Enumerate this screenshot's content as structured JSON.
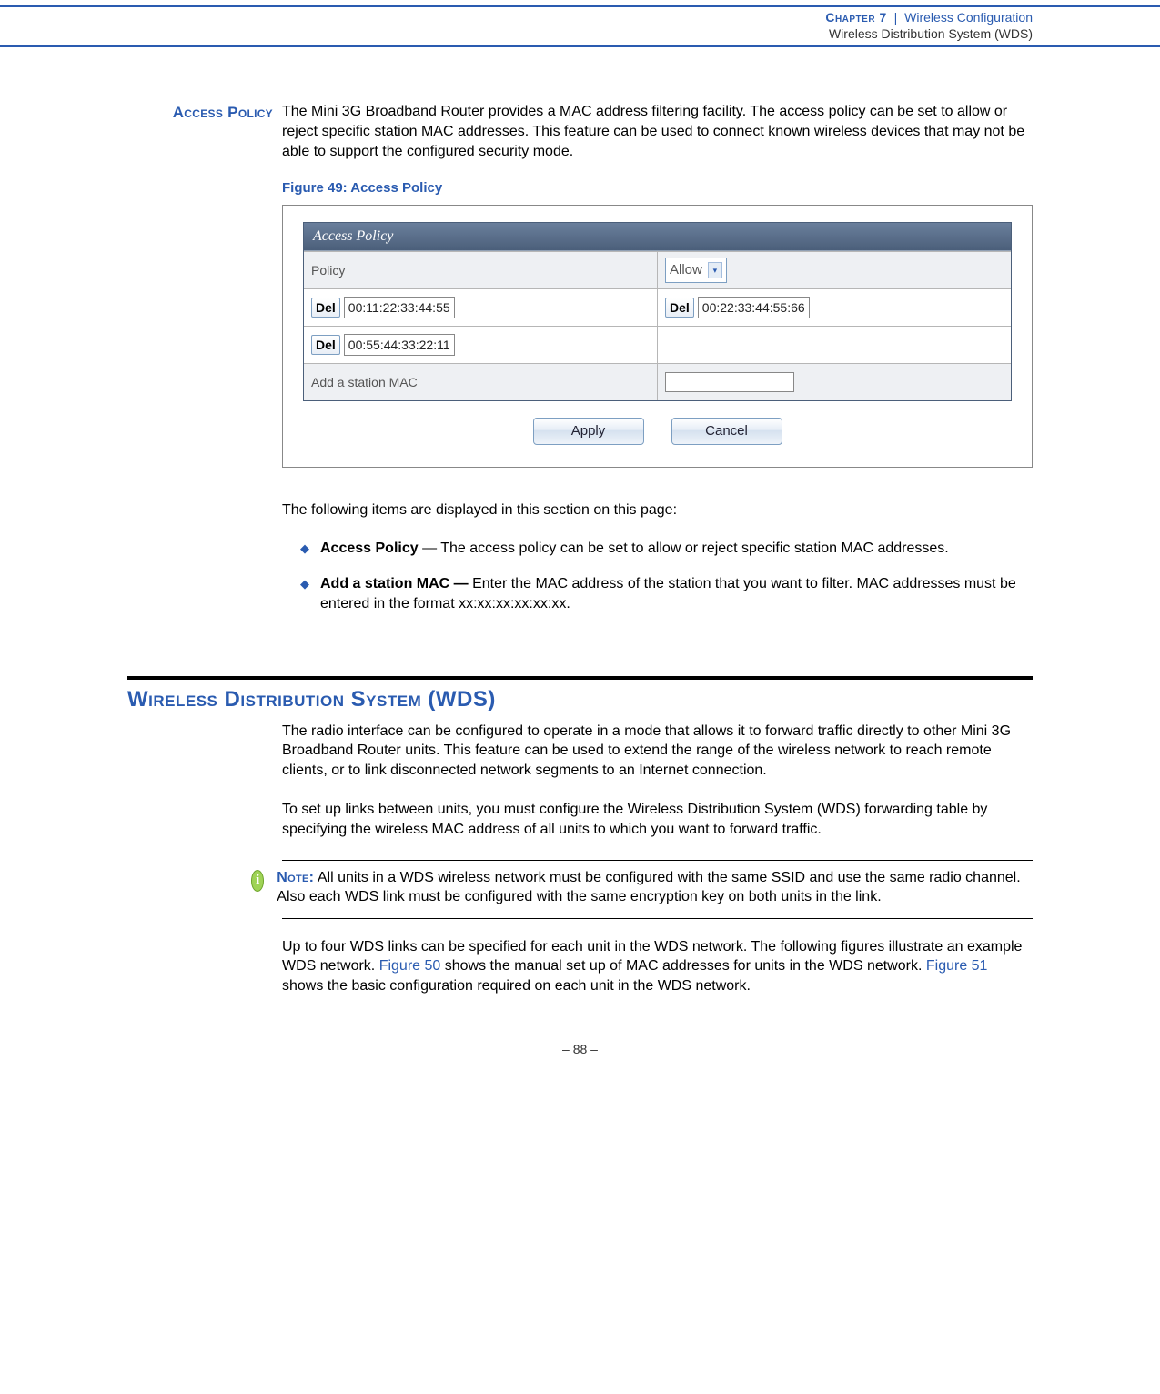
{
  "header": {
    "chapter": "Chapter 7",
    "pipe": "|",
    "topic": "Wireless Configuration",
    "subtitle": "Wireless Distribution System (WDS)"
  },
  "access": {
    "label": "Access Policy",
    "intro": "The Mini 3G Broadband Router provides a MAC address filtering facility. The access policy can be set to allow or reject specific station MAC addresses. This feature can be used to connect known wireless devices that may not be able to support the configured security mode.",
    "figcap": "Figure 49:  Access Policy",
    "panel": {
      "title": "Access Policy",
      "policy_label": "Policy",
      "policy_value": "Allow",
      "del": "Del",
      "mac1": "00:11:22:33:44:55",
      "mac2": "00:22:33:44:55:66",
      "mac3": "00:55:44:33:22:11",
      "addlabel": "Add a station MAC",
      "apply": "Apply",
      "cancel": "Cancel"
    },
    "after": "The following items are displayed in this section on this page:",
    "bullets": [
      {
        "head": "Access Policy",
        "sep": " — ",
        "text": "The access policy can be set to allow or reject specific station MAC addresses."
      },
      {
        "head": "Add a station MAC — ",
        "sep": "",
        "text": "Enter the MAC address of the station that you want to filter. MAC addresses must be entered in the format xx:xx:xx:xx:xx:xx."
      }
    ]
  },
  "wds": {
    "heading": "Wireless Distribution System (WDS)",
    "p1": "The radio interface can be configured to operate in a mode that allows it to forward traffic directly to other Mini 3G Broadband Router units. This feature can be used to extend the range of the wireless network to reach remote clients, or to link disconnected network segments to an Internet connection.",
    "p2": "To set up links between units, you must configure the Wireless Distribution System (WDS) forwarding table by specifying the wireless MAC address of all units to which you want to forward traffic.",
    "note_label": "Note:",
    "note": " All units in a WDS wireless network must be configured with the same SSID and use the same radio channel. Also each WDS link must be configured with the same encryption key on both units in the link.",
    "p3a": "Up to four WDS links can be specified for each unit in the WDS network. The following figures illustrate an example WDS network. ",
    "fig50": "Figure 50",
    "p3b": " shows the manual set up of MAC addresses for units in the WDS network. ",
    "fig51": "Figure 51",
    "p3c": " shows the basic configuration required on each unit in the WDS network."
  },
  "footer": "–  88  –"
}
